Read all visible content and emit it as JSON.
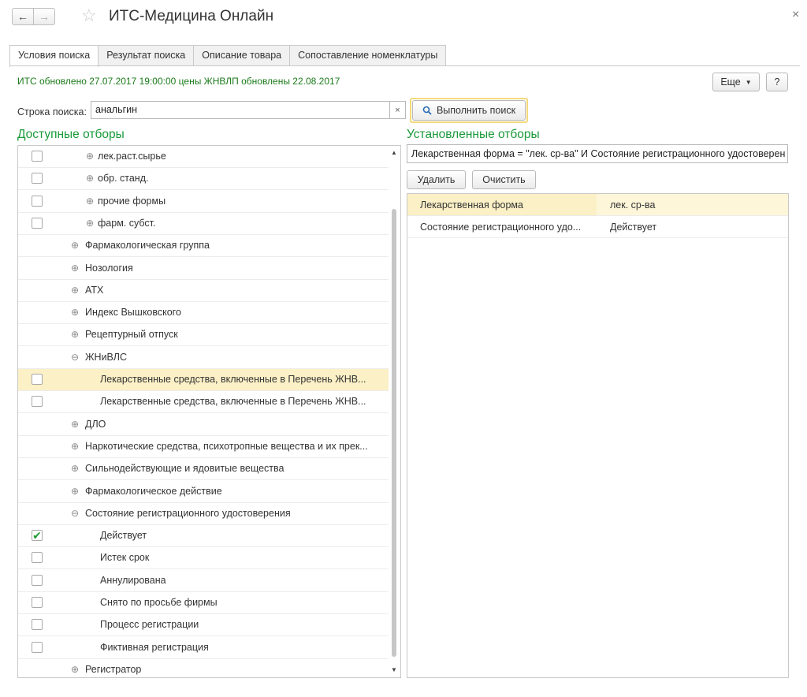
{
  "window": {
    "title": "ИТС-Медицина Онлайн",
    "back_icon": "←",
    "forward_icon": "→",
    "star_icon": "☆",
    "close_icon": "×"
  },
  "tabs": [
    {
      "label": "Условия поиска",
      "active": true
    },
    {
      "label": "Результат поиска",
      "active": false
    },
    {
      "label": "Описание товара",
      "active": false
    },
    {
      "label": "Сопоставление номенклатуры",
      "active": false
    }
  ],
  "info_text": "ИТС обновлено 27.07.2017 19:00:00  цены ЖНВЛП обновлены 22.08.2017",
  "more_button": "Еще",
  "help_button": "?",
  "search": {
    "label": "Строка поиска:",
    "value": "анальгин",
    "clear_icon": "×",
    "button_label": "Выполнить поиск"
  },
  "available_filters": {
    "title": "Доступные отборы",
    "rows": [
      {
        "label": "лек.раст.сырье",
        "checkbox": true,
        "checked": false,
        "expander": "⊕",
        "level": 2
      },
      {
        "label": "обр. станд.",
        "checkbox": true,
        "checked": false,
        "expander": "⊕",
        "level": 2
      },
      {
        "label": "прочие формы",
        "checkbox": true,
        "checked": false,
        "expander": "⊕",
        "level": 2
      },
      {
        "label": "фарм. субст.",
        "checkbox": true,
        "checked": false,
        "expander": "⊕",
        "level": 2
      },
      {
        "label": "Фармакологическая группа",
        "checkbox": false,
        "checked": false,
        "expander": "⊕",
        "level": 1
      },
      {
        "label": "Нозология",
        "checkbox": false,
        "checked": false,
        "expander": "⊕",
        "level": 1
      },
      {
        "label": "АТХ",
        "checkbox": false,
        "checked": false,
        "expander": "⊕",
        "level": 1
      },
      {
        "label": "Индекс Вышковского",
        "checkbox": false,
        "checked": false,
        "expander": "⊕",
        "level": 1
      },
      {
        "label": "Рецептурный отпуск",
        "checkbox": false,
        "checked": false,
        "expander": "⊕",
        "level": 1
      },
      {
        "label": "ЖНиВЛС",
        "checkbox": false,
        "checked": false,
        "expander": "⊖",
        "level": 1
      },
      {
        "label": "Лекарственные средства, включенные в Перечень ЖНВ...",
        "checkbox": true,
        "checked": false,
        "expander": "",
        "level": 3,
        "selected": true
      },
      {
        "label": "Лекарственные средства, включенные в Перечень ЖНВ...",
        "checkbox": true,
        "checked": false,
        "expander": "",
        "level": 3
      },
      {
        "label": "ДЛО",
        "checkbox": false,
        "checked": false,
        "expander": "⊕",
        "level": 1
      },
      {
        "label": "Наркотические средства, психотропные вещества и их прек...",
        "checkbox": false,
        "checked": false,
        "expander": "⊕",
        "level": 1
      },
      {
        "label": "Сильнодействующие и ядовитые вещества",
        "checkbox": false,
        "checked": false,
        "expander": "⊕",
        "level": 1
      },
      {
        "label": "Фармакологическое действие",
        "checkbox": false,
        "checked": false,
        "expander": "⊕",
        "level": 1
      },
      {
        "label": "Состояние регистрационного удостоверения",
        "checkbox": false,
        "checked": false,
        "expander": "⊖",
        "level": 1
      },
      {
        "label": "Действует",
        "checkbox": true,
        "checked": true,
        "expander": "",
        "level": 3
      },
      {
        "label": "Истек срок",
        "checkbox": true,
        "checked": false,
        "expander": "",
        "level": 3
      },
      {
        "label": "Аннулирована",
        "checkbox": true,
        "checked": false,
        "expander": "",
        "level": 3
      },
      {
        "label": "Снято по просьбе фирмы",
        "checkbox": true,
        "checked": false,
        "expander": "",
        "level": 3
      },
      {
        "label": "Процесс регистрации",
        "checkbox": true,
        "checked": false,
        "expander": "",
        "level": 3
      },
      {
        "label": "Фиктивная регистрация",
        "checkbox": true,
        "checked": false,
        "expander": "",
        "level": 3
      },
      {
        "label": "Регистратор",
        "checkbox": false,
        "checked": false,
        "expander": "⊕",
        "level": 1
      }
    ]
  },
  "set_filters": {
    "title": "Установленные отборы",
    "expression": "Лекарственная форма = \"лек. ср-ва\" И Состояние регистрационного удостоверен",
    "delete_button": "Удалить",
    "clear_button": "Очистить",
    "rows": [
      {
        "field": "Лекарственная форма",
        "value": "лек. ср-ва",
        "selected": true
      },
      {
        "field": "Состояние регистрационного удо...",
        "value": "Действует",
        "selected": false
      }
    ]
  },
  "colors": {
    "accent_green": "#1a9a3a",
    "selection": "#fbf0c6",
    "highlight_border": "#f3d97a"
  }
}
